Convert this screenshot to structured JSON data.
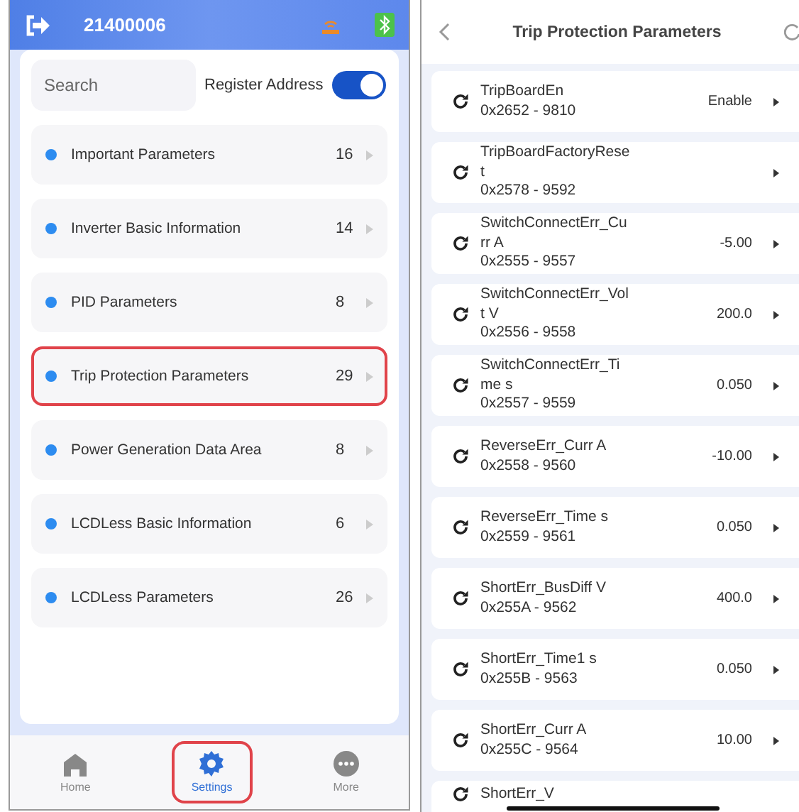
{
  "settings_screen": {
    "device_id": "21400006",
    "search": {
      "placeholder": "Search"
    },
    "register_address": {
      "label": "Register Address",
      "on": true
    },
    "groups": [
      {
        "label": "Important Parameters",
        "count": "16",
        "highlighted": false
      },
      {
        "label": "Inverter Basic Information",
        "count": "14",
        "highlighted": false
      },
      {
        "label": "PID Parameters",
        "count": "8",
        "highlighted": false
      },
      {
        "label": "Trip Protection Parameters",
        "count": "29",
        "highlighted": true
      },
      {
        "label": "Power Generation Data Area",
        "count": "8",
        "highlighted": false
      },
      {
        "label": "LCDLess Basic Information",
        "count": "6",
        "highlighted": false
      },
      {
        "label": "LCDLess Parameters",
        "count": "26",
        "highlighted": false
      }
    ],
    "tab_bar": [
      {
        "kind": "home",
        "label": "Home",
        "selected": false,
        "highlighted": false
      },
      {
        "kind": "settings",
        "label": "Settings",
        "selected": true,
        "highlighted": true
      },
      {
        "kind": "more",
        "label": "More",
        "selected": false,
        "highlighted": false
      }
    ]
  },
  "parameters_screen": {
    "title": "Trip Protection Parameters",
    "parameters": [
      {
        "name": "TripBoardEn",
        "address": "0x2652 - 9810",
        "value": "Enable"
      },
      {
        "name": "TripBoardFactoryReset",
        "address": "0x2578 - 9592"
      },
      {
        "name": "SwitchConnectErr_Curr A",
        "address": "0x2555 - 9557",
        "value": "-5.00"
      },
      {
        "name": "SwitchConnectErr_Volt V",
        "address": "0x2556 - 9558",
        "value": "200.0"
      },
      {
        "name": "SwitchConnectErr_Time s",
        "address": "0x2557 - 9559",
        "value": "0.050"
      },
      {
        "name": "ReverseErr_Curr A",
        "address": "0x2558 - 9560",
        "value": "-10.00"
      },
      {
        "name": "ReverseErr_Time s",
        "address": "0x2559 - 9561",
        "value": "0.050"
      },
      {
        "name": "ShortErr_BusDiff V",
        "address": "0x255A - 9562",
        "value": "400.0"
      },
      {
        "name": "ShortErr_Time1 s",
        "address": "0x255B - 9563",
        "value": "0.050"
      },
      {
        "name": "ShortErr_Curr A",
        "address": "0x255C - 9564",
        "value": "10.00"
      },
      {
        "name": "ShortErr_V"
      }
    ]
  }
}
